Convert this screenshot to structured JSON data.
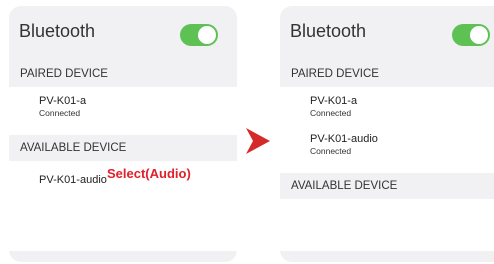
{
  "left_panel": {
    "title": "Bluetooth",
    "toggle_on": true,
    "paired_header": "PAIRED DEVICE",
    "paired_devices": [
      {
        "name": "PV-K01-a",
        "status": "Connected"
      }
    ],
    "available_header": "AVAILABLE DEVICE",
    "available_devices": [
      {
        "name": "PV-K01-audio"
      }
    ],
    "select_note": "Select(Audio)"
  },
  "right_panel": {
    "title": "Bluetooth",
    "toggle_on": true,
    "paired_header": "PAIRED DEVICE",
    "paired_devices": [
      {
        "name": "PV-K01-a",
        "status": "Connected"
      },
      {
        "name": "PV-K01-audio",
        "status": "Connected"
      }
    ],
    "available_header": "AVAILABLE DEVICE"
  },
  "colors": {
    "toggle_on": "#5ec153",
    "arrow": "#d42a2a",
    "select_note": "#e0202a"
  },
  "icons": {
    "step_arrow": "chevron-right-icon"
  }
}
